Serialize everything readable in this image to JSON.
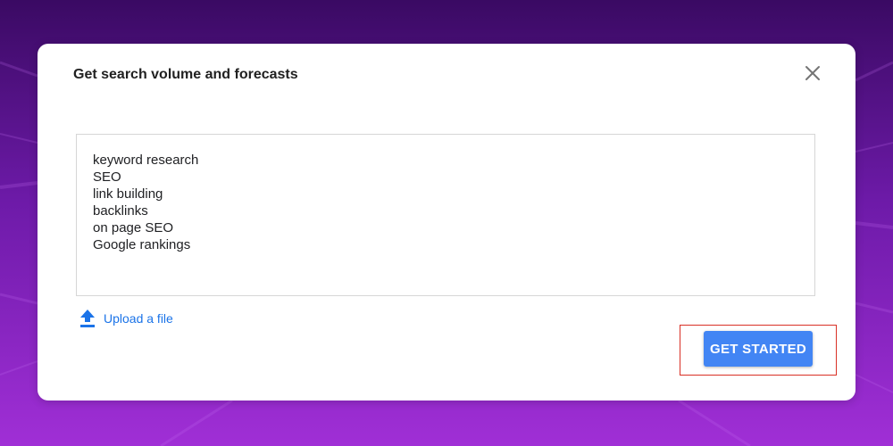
{
  "dialog": {
    "title": "Get search volume and forecasts",
    "close_icon": "close-icon"
  },
  "keywords": {
    "lines": [
      "keyword research",
      "SEO",
      "link building",
      "backlinks",
      "on page SEO",
      "Google rankings"
    ]
  },
  "upload": {
    "icon": "upload-icon",
    "label": "Upload a file"
  },
  "actions": {
    "get_started_label": "GET STARTED"
  },
  "colors": {
    "accent_blue": "#4285f4",
    "link_blue": "#1a73e8",
    "highlight_red": "#d93025",
    "background_top": "#3a0a63",
    "background_bottom": "#a02fd6"
  }
}
